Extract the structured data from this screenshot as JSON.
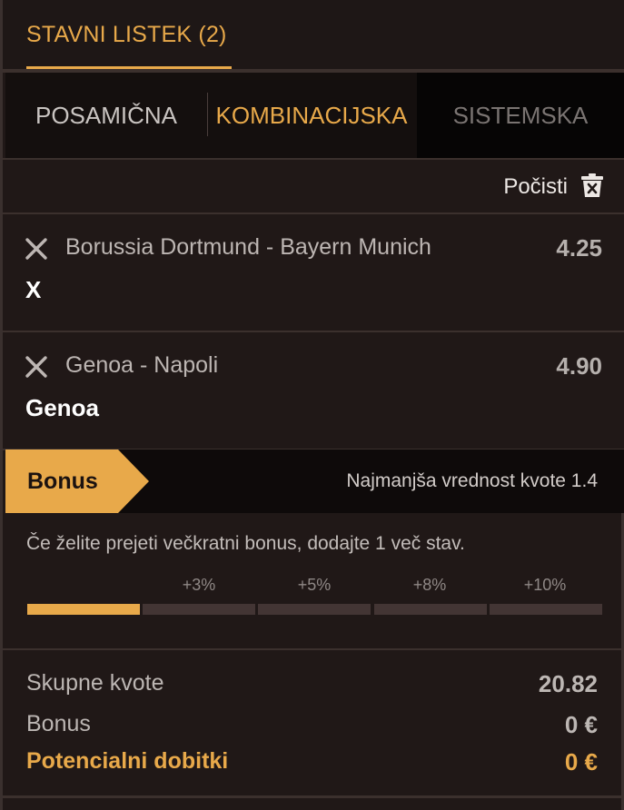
{
  "header": {
    "title": "STAVNI LISTEK (2)"
  },
  "tabs": [
    {
      "label": "POSAMIČNA",
      "active": false
    },
    {
      "label": "KOMBINACIJSKA",
      "active": true
    },
    {
      "label": "SISTEMSKA",
      "active": false
    }
  ],
  "clear": {
    "label": "Počisti",
    "icon": "trash-icon"
  },
  "bets": [
    {
      "match": "Borussia Dortmund - Bayern Munich",
      "odds": "4.25",
      "pick": "X"
    },
    {
      "match": "Genoa - Napoli",
      "odds": "4.90",
      "pick": "Genoa"
    }
  ],
  "bonus": {
    "tag": "Bonus",
    "min_odds": "Najmanjša vrednost kvote 1.4",
    "info": "Če želite prejeti večkratni bonus, dodajte 1 več stav.",
    "steps": [
      "+3%",
      "+5%",
      "+8%",
      "+10%"
    ],
    "progress_filled_segments": 1,
    "progress_total_segments": 5
  },
  "totals": {
    "odds_label": "Skupne kvote",
    "odds_value": "20.82",
    "bonus_label": "Bonus",
    "bonus_value": "0 €",
    "potential_label": "Potencialni dobitki",
    "potential_value": "0 €"
  },
  "colors": {
    "accent": "#e8a94a",
    "background": "#201817",
    "tab_background": "#140f0e"
  }
}
